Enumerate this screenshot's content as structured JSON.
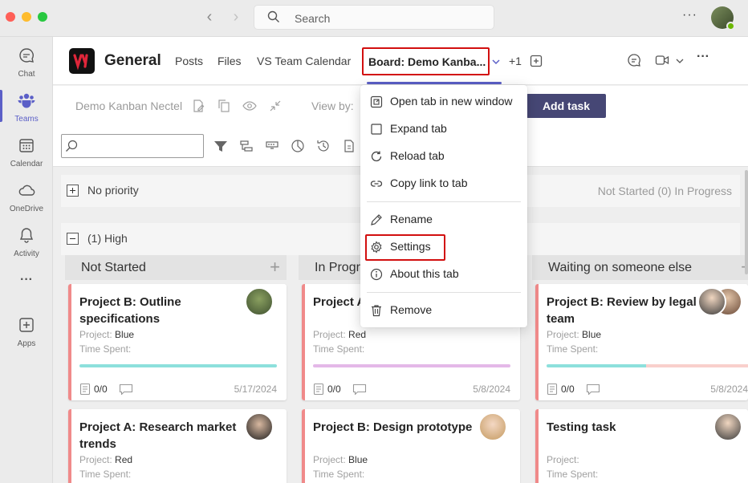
{
  "titlebar": {
    "search_placeholder": "Search",
    "more": "···"
  },
  "rail": [
    {
      "label": "Chat",
      "icon": "chat-icon"
    },
    {
      "label": "Teams",
      "icon": "teams-icon",
      "active": true
    },
    {
      "label": "Calendar",
      "icon": "calendar-icon"
    },
    {
      "label": "OneDrive",
      "icon": "cloud-icon"
    },
    {
      "label": "Activity",
      "icon": "bell-icon"
    },
    {
      "label": "···",
      "icon": "more-icon"
    },
    {
      "label": "Apps",
      "icon": "add-apps-icon"
    }
  ],
  "channel": {
    "title": "General",
    "tabs": [
      "Posts",
      "Files",
      "VS Team Calendar"
    ],
    "active_tab": "Board: Demo Kanba...",
    "extra_tabs": "+1"
  },
  "toolbar": {
    "board_name": "Demo Kanban Nectel",
    "view_by": "View by:",
    "add_task": "Add task"
  },
  "groups": [
    {
      "label": "No priority",
      "status": "Not Started (0)  In Progress",
      "collapsed": true
    },
    {
      "label": "(1) High",
      "collapsed": false
    }
  ],
  "columns": [
    "Not Started",
    "In Progr",
    "Waiting on someone else"
  ],
  "cards": [
    {
      "title": "Project B: Outline specifications",
      "project_label": "Project:",
      "project": "Blue",
      "time_label": "Time Spent:",
      "count": "0/0",
      "date": "5/17/2024",
      "bar_color": "#8de0dc"
    },
    {
      "title": "Project A",
      "project_label": "Project:",
      "project": "Red",
      "time_label": "Time Spent:",
      "count": "0/0",
      "date": "5/8/2024",
      "bar_color": "#e4b8e8"
    },
    {
      "title": "Project B: Review by legal team",
      "project_label": "Project:",
      "project": "Blue",
      "time_label": "Time Spent:",
      "count": "0/0",
      "date": "5/8/2024",
      "bar_color": "#8de0dc",
      "bar_color_2": "#f9d0cc"
    },
    {
      "title": "Project A: Research market trends",
      "project_label": "Project:",
      "project": "Red",
      "time_label": "Time Spent:"
    },
    {
      "title": "Project B: Design prototype",
      "project_label": "Project:",
      "project": "Blue",
      "time_label": "Time Spent:"
    },
    {
      "title": "Testing task",
      "project_label": "Project:",
      "project": "",
      "time_label": "Time Spent:"
    }
  ],
  "menu": {
    "items": [
      {
        "label": "Open tab in new window",
        "icon": "open-window-icon"
      },
      {
        "label": "Expand tab",
        "icon": "expand-icon"
      },
      {
        "label": "Reload tab",
        "icon": "reload-icon"
      },
      {
        "label": "Copy link to tab",
        "icon": "link-icon"
      },
      {
        "label": "Rename",
        "icon": "pencil-icon"
      },
      {
        "label": "Settings",
        "icon": "gear-icon",
        "highlighted": true
      },
      {
        "label": "About this tab",
        "icon": "info-icon"
      },
      {
        "label": "Remove",
        "icon": "trash-icon"
      }
    ]
  },
  "colors": {
    "accent": "#5b5fc7",
    "add_task_bg": "#464775",
    "highlight_border": "#d20f0f",
    "card_stripe": "#f08a8a"
  }
}
